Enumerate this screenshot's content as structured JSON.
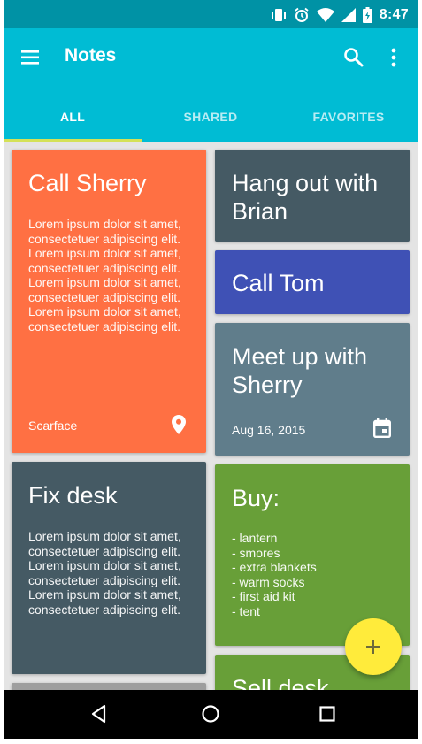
{
  "status_bar": {
    "time": "8:47",
    "icons": [
      "vibrate-icon",
      "alarm-icon",
      "wifi-icon",
      "signal-icon",
      "battery-icon"
    ]
  },
  "app_bar": {
    "title": "Notes",
    "icons": [
      "menu-icon",
      "search-icon",
      "more-vert-icon"
    ]
  },
  "tabs": [
    {
      "label": "ALL",
      "active": true
    },
    {
      "label": "SHARED",
      "active": false
    },
    {
      "label": "FAVORITES",
      "active": false
    }
  ],
  "notes": {
    "call_sherry": {
      "title": "Call Sherry",
      "body": "Lorem ipsum dolor sit amet, consectetuer adipiscing elit. Lorem ipsum dolor sit amet, consectetuer adipiscing elit. Lorem ipsum dolor sit amet, consectetuer adipiscing elit. Lorem ipsum dolor sit amet, consectetuer adipiscing elit.",
      "footer": "Scarface",
      "footer_icon": "location-pin-icon",
      "color": "#ff7043"
    },
    "hang_out": {
      "title": "Hang out with Brian",
      "color": "#455a64"
    },
    "call_tom": {
      "title": "Call Tom",
      "color": "#3f51b5"
    },
    "meet_up": {
      "title": "Meet up with Sherry",
      "footer": "Aug 16, 2015",
      "footer_icon": "calendar-icon",
      "color": "#607d8b"
    },
    "fix_desk": {
      "title": "Fix desk",
      "body": "Lorem ipsum dolor sit amet, consectetuer adipiscing elit. Lorem ipsum dolor sit amet, consectetuer adipiscing elit. Lorem ipsum dolor sit amet, consectetuer adipiscing elit.",
      "color": "#455a64"
    },
    "buy": {
      "title": "Buy:",
      "items": [
        "- lantern",
        "- smores",
        "- extra blankets",
        "- warm socks",
        "- first aid kit",
        "- tent"
      ],
      "color": "#689f38"
    },
    "sell_desk": {
      "title": "Sell desk",
      "color": "#689f38"
    }
  },
  "fab": {
    "icon": "add-icon",
    "color": "#ffeb3b"
  },
  "nav_bar": {
    "icons": [
      "back-icon",
      "home-icon",
      "recents-icon"
    ]
  },
  "colors": {
    "primary": "#00bcd4",
    "primary_dark": "#0092a5",
    "accent": "#d4e157"
  }
}
